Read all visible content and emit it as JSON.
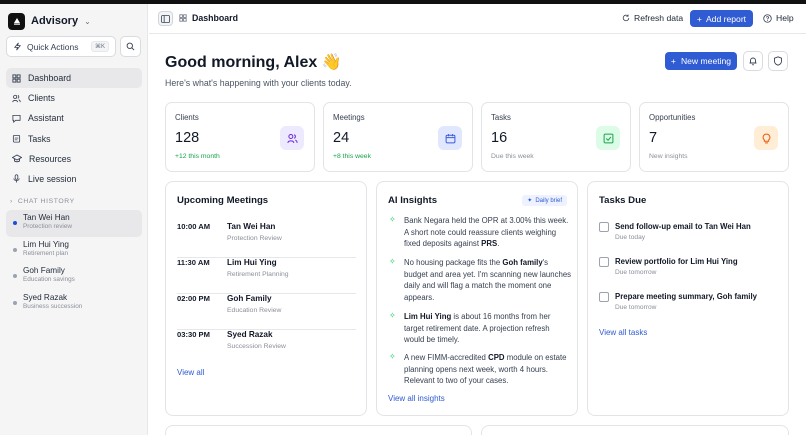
{
  "app": {
    "name": "Advisory"
  },
  "sidebar": {
    "quick_actions": {
      "label": "Quick Actions",
      "shortcut": "⌘K"
    },
    "nav": [
      {
        "label": "Dashboard",
        "icon": "grid-icon",
        "active": true
      },
      {
        "label": "Clients",
        "icon": "users-icon",
        "active": false
      },
      {
        "label": "Assistant",
        "icon": "chat-icon",
        "active": false
      },
      {
        "label": "Tasks",
        "icon": "clipboard-icon",
        "active": false
      },
      {
        "label": "Resources",
        "icon": "graduation-cap-icon",
        "active": false
      },
      {
        "label": "Live session",
        "icon": "microphone-icon",
        "active": false
      }
    ],
    "chat_history_title": "CHAT HISTORY",
    "chats": [
      {
        "name": "Tan Wei Han",
        "topic": "Protection review"
      },
      {
        "name": "Lim Hui Ying",
        "topic": "Retirement plan"
      },
      {
        "name": "Goh Family",
        "topic": "Education savings"
      },
      {
        "name": "Syed Razak",
        "topic": "Business succession"
      }
    ]
  },
  "header": {
    "breadcrumb": "Dashboard",
    "refresh_label": "Refresh data",
    "add_report_label": "Add report",
    "help_label": "Help"
  },
  "main": {
    "greeting": "Good morning, Alex 👋",
    "subtitle": "Here's what's happening with your clients today.",
    "new_meeting_label": "New meeting",
    "stats": [
      {
        "label": "Clients",
        "value": "128",
        "sub": "+12 this month",
        "icon": "users-icon"
      },
      {
        "label": "Meetings",
        "value": "24",
        "sub": "+8 this week",
        "icon": "calendar-icon"
      },
      {
        "label": "Tasks",
        "value": "16",
        "sub": "Due this week",
        "icon": "check-square-icon"
      },
      {
        "label": "Opportunities",
        "value": "7",
        "sub": "New insights",
        "icon": "lightbulb-icon"
      }
    ],
    "meetings": {
      "title": "Upcoming Meetings",
      "items": [
        {
          "time": "10:00 AM",
          "name": "Tan Wei Han",
          "type": "Protection Review"
        },
        {
          "time": "11:30 AM",
          "name": "Lim Hui Ying",
          "type": "Retirement Planning"
        },
        {
          "time": "02:00 PM",
          "name": "Goh Family",
          "type": "Education Review"
        },
        {
          "time": "03:30 PM",
          "name": "Syed Razak",
          "type": "Succession Review"
        }
      ],
      "view_all": "View all"
    },
    "insights": {
      "title": "AI Insights",
      "badge": "Daily brief",
      "items": [
        {
          "pre": "Bank Negara held the OPR at 3.00% this week. A short note could reassure clients weighing fixed deposits against ",
          "bold": "PRS",
          "post": "."
        },
        {
          "pre": "No housing package fits the ",
          "bold": "Goh family",
          "post": "'s budget and area yet. I'm scanning new launches daily and will flag a match the moment one appears."
        },
        {
          "pre": "",
          "bold": "Lim Hui Ying",
          "post": " is about 16 months from her target retirement date. A projection refresh would be timely."
        },
        {
          "pre": "A new FIMM-accredited ",
          "bold": "CPD",
          "post": " module on estate planning opens next week, worth 4 hours. Relevant to two of your cases."
        }
      ],
      "view_all": "View all insights"
    },
    "tasks": {
      "title": "Tasks Due",
      "items": [
        {
          "name": "Send follow-up email to Tan Wei Han",
          "due": "Due today"
        },
        {
          "name": "Review portfolio for Lim Hui Ying",
          "due": "Due tomorrow"
        },
        {
          "name": "Prepare meeting summary, Goh family",
          "due": "Due tomorrow"
        }
      ],
      "view_all": "View all tasks"
    }
  }
}
